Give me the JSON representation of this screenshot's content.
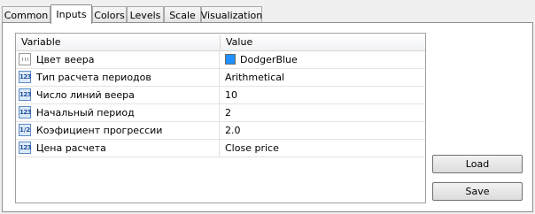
{
  "tabs": [
    {
      "label": "Common"
    },
    {
      "label": "Inputs"
    },
    {
      "label": "Colors"
    },
    {
      "label": "Levels"
    },
    {
      "label": "Scale"
    },
    {
      "label": "Visualization"
    }
  ],
  "active_tab": "Inputs",
  "grid": {
    "columns": {
      "variable": "Variable",
      "value": "Value"
    },
    "rows": [
      {
        "name": "Цвет веера",
        "value": "DodgerBlue",
        "icon": "color-icon",
        "swatch_color": "#1e90ff"
      },
      {
        "name": "Тип расчета периодов",
        "value": "Arithmetical",
        "icon": "integer-icon"
      },
      {
        "name": "Число линий веера",
        "value": "10",
        "icon": "integer-icon"
      },
      {
        "name": "Начальный период",
        "value": "2",
        "icon": "integer-icon"
      },
      {
        "name": "Коэфициент прогрессии",
        "value": "2.0",
        "icon": "double-icon"
      },
      {
        "name": "Цена расчета",
        "value": "Close price",
        "icon": "integer-icon"
      }
    ]
  },
  "buttons": {
    "load": "Load",
    "save": "Save"
  },
  "icon_text": {
    "integer": "123",
    "double": "1/2"
  }
}
